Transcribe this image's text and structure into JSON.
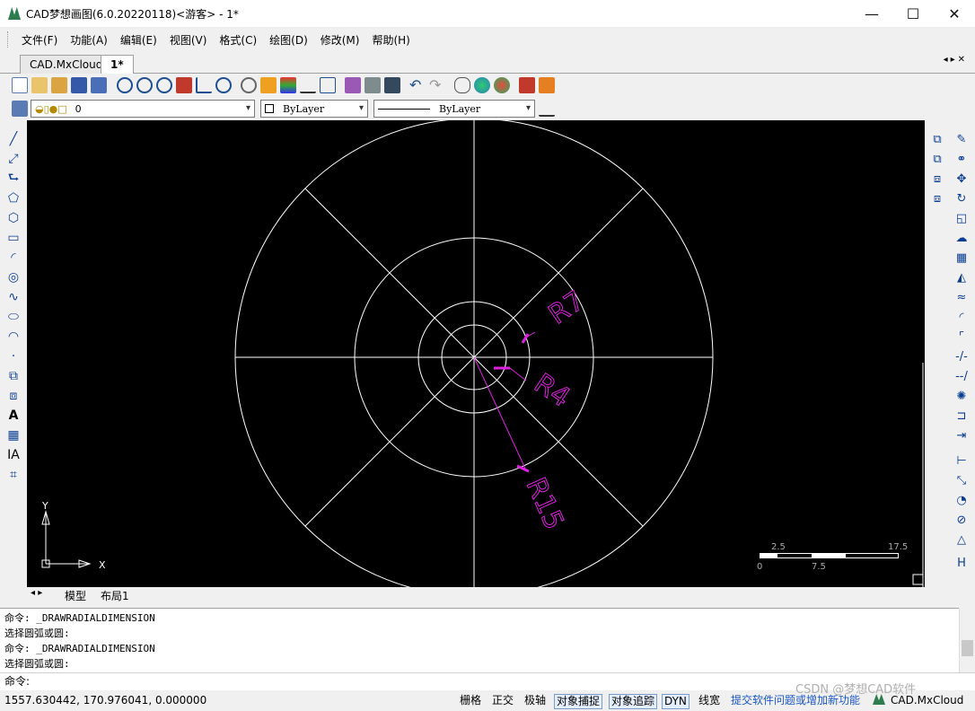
{
  "window": {
    "title": "CAD梦想画图(6.0.20220118)<游客> - 1*",
    "controls": [
      "minimize-icon",
      "maximize-icon",
      "close-icon"
    ]
  },
  "menu": [
    "文件(F)",
    "功能(A)",
    "编辑(E)",
    "视图(V)",
    "格式(C)",
    "绘图(D)",
    "修改(M)",
    "帮助(H)"
  ],
  "tabs": [
    {
      "label": "CAD.MxCloud",
      "active": false
    },
    {
      "label": "1*",
      "active": true
    }
  ],
  "properties": {
    "layer": "0",
    "color": "ByLayer",
    "linetype": "ByLayer"
  },
  "drawing": {
    "dimensions": [
      "R7",
      "R4",
      "R15"
    ],
    "ucs": {
      "x_label": "X",
      "y_label": "Y"
    },
    "scale_bar": {
      "top_labels": [
        "2.5",
        "17.5"
      ],
      "bottom_labels": [
        "0",
        "7.5"
      ]
    },
    "dim_color": "#e020e0"
  },
  "sheet_tabs": [
    "模型",
    "布局1"
  ],
  "command_history": [
    "命令: _DRAWRADIALDIMENSION",
    " 选择圆弧或圆:",
    "命令: _DRAWRADIALDIMENSION",
    " 选择圆弧或圆:"
  ],
  "command_prompt": "命令:",
  "status": {
    "coords": "1557.630442,  170.976041,  0.000000",
    "toggles": [
      {
        "label": "栅格",
        "on": false
      },
      {
        "label": "正交",
        "on": false
      },
      {
        "label": "极轴",
        "on": false
      },
      {
        "label": "对象捕捉",
        "on": true
      },
      {
        "label": "对象追踪",
        "on": true
      },
      {
        "label": "DYN",
        "on": true
      },
      {
        "label": "线宽",
        "on": false
      }
    ],
    "feedback_link": "提交软件问题或增加新功能",
    "brand": "CAD.MxCloud",
    "watermark": "CSDN @梦想CAD软件"
  }
}
